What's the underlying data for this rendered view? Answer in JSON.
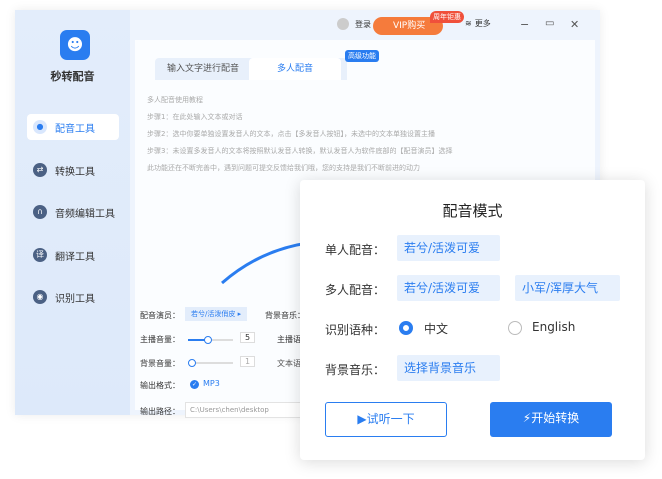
{
  "app": {
    "name": "秒转配音"
  },
  "sidebar": {
    "items": [
      {
        "label": "配音工具",
        "icon": "mic-icon"
      },
      {
        "label": "转换工具",
        "icon": "swap-icon"
      },
      {
        "label": "音频编辑工具",
        "icon": "headphones-icon"
      },
      {
        "label": "翻译工具",
        "icon": "translate-icon"
      },
      {
        "label": "识别工具",
        "icon": "eye-icon"
      }
    ]
  },
  "topbar": {
    "login": "登录",
    "vip": "VIP购买",
    "vip_badge": "周年钜惠",
    "more": "更多"
  },
  "tabs": {
    "text": "输入文字进行配音",
    "multi": "多人配音",
    "adv_badge": "高级功能"
  },
  "help": [
    "多人配音使用教程",
    "步骤1：在此处输入文本或对话",
    "步骤2：选中你要单独设置发音人的文本，点击【多发音人按钮】，未选中的文本单独设置主播",
    "步骤3：未设置多发音人的文本将按照默认发音人转换，默认发音人为软件底部的【配音演员】选择",
    "此功能还在不断完善中，遇到问题可提交反馈给我们哦，您的支持是我们不断前进的动力"
  ],
  "settings": {
    "actor_label": "配音演员：",
    "actor_value": "若兮/活泼俏皮",
    "bgm_label": "背景音乐：",
    "volume_label": "主播音量：",
    "volume_value": "5",
    "speed_label": "主播语速",
    "bg_volume_label": "背景音量：",
    "bg_volume_value": "1",
    "text_lang_label": "文本语言",
    "format_label": "输出格式：",
    "format_value": "MP3",
    "path_label": "输出路径：",
    "path_value": "C:\\Users\\chen\\desktop"
  },
  "card": {
    "title": "配音模式",
    "single_label": "单人配音：",
    "single_voice": "若兮/活泼可爱",
    "multi_label": "多人配音：",
    "multi_voice1": "若兮/活泼可爱",
    "multi_voice2": "小军/浑厚大气",
    "lang_label": "识别语种：",
    "lang_zh": "中文",
    "lang_en": "English",
    "lang_selected": "中文",
    "bgm_label": "背景音乐：",
    "bgm_button": "选择背景音乐",
    "preview_button": "试听一下",
    "start_button": "开始转换"
  },
  "colors": {
    "accent": "#2a7df0",
    "vip": "#f57b3c"
  }
}
